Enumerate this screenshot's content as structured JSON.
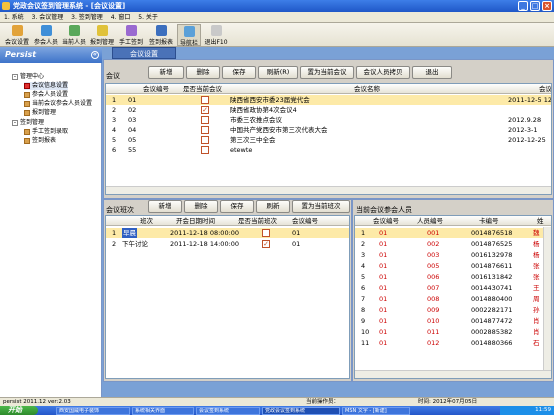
{
  "window": {
    "title": "党政会议签到管理系统 - [会议设置]"
  },
  "menu": [
    "1. 系统",
    "3. 会议管理",
    "3. 签到管理",
    "4. 窗口",
    "5. 关于"
  ],
  "toolbar": [
    {
      "label": "会议设置",
      "color": "#e2a33a"
    },
    {
      "label": "参会人员",
      "color": "#3f8fd8"
    },
    {
      "label": "当前人员",
      "color": "#5aa85a"
    },
    {
      "label": "报到管理",
      "color": "#e0c23a"
    },
    {
      "label": "手工签到",
      "color": "#9a6ad0"
    },
    {
      "label": "签到报表",
      "color": "#3c6fbe"
    },
    {
      "label": "导航栏",
      "color": "#5aa0d8"
    },
    {
      "label": "退出F10",
      "color": "#c9c9c9"
    }
  ],
  "left": {
    "title": "Persist",
    "collapse": "«",
    "tree": [
      {
        "label": "管理中心",
        "level": 0,
        "kind": "box",
        "mark": "-"
      },
      {
        "label": "会议信息设置",
        "level": 1,
        "kind": "doc",
        "selected": true
      },
      {
        "label": "参会人员设置",
        "level": 1,
        "kind": "doc"
      },
      {
        "label": "当前会议参会人员设置",
        "level": 1,
        "kind": "doc"
      },
      {
        "label": "报到管理",
        "level": 1,
        "kind": "doc"
      },
      {
        "label": "签到管理",
        "level": 0,
        "kind": "box",
        "mark": "-"
      },
      {
        "label": "手工签到录取",
        "level": 1,
        "kind": "doc"
      },
      {
        "label": "签到报表",
        "level": 1,
        "kind": "doc"
      }
    ]
  },
  "tab": {
    "label": "会议设置"
  },
  "meeting": {
    "title": "会议",
    "buttons": [
      "新增",
      "删除",
      "保存",
      "刷新(R)",
      "置为当前会议",
      "会议人员拷贝",
      "退出"
    ],
    "headers": [
      "会议编号",
      "是否当前会议",
      "会议名称",
      "会议"
    ],
    "rows": [
      {
        "idx": "1",
        "code": "01",
        "current": false,
        "name": "陕西省西安市委23届党代会",
        "date": "2011-12-5 12"
      },
      {
        "idx": "2",
        "code": "02",
        "current": true,
        "name": "陕西省政协第4次会议4",
        "date": ""
      },
      {
        "idx": "3",
        "code": "03",
        "current": false,
        "name": "市委三农推点会议",
        "date": "2012.9.28"
      },
      {
        "idx": "4",
        "code": "04",
        "current": false,
        "name": "中国共产党西安市第三次代表大会",
        "date": "2012-3-1"
      },
      {
        "idx": "5",
        "code": "05",
        "current": false,
        "name": "第三次三中全会",
        "date": "2012-12-25"
      },
      {
        "idx": "6",
        "code": "55",
        "current": false,
        "name": "etewte",
        "date": ""
      }
    ]
  },
  "session": {
    "title": "会议班次",
    "buttons": [
      "新增",
      "删除",
      "保存",
      "刷新",
      "置为当前班次"
    ],
    "headers": [
      "班次",
      "开会日期时间",
      "是否当前班次",
      "会议编号"
    ],
    "rows": [
      {
        "idx": "1",
        "name": "早晨",
        "time": "2011-12-18 08:00:00",
        "current": false,
        "code": "01"
      },
      {
        "idx": "2",
        "name": "下午讨论",
        "time": "2011-12-18 14:00:00",
        "current": true,
        "code": "01"
      }
    ]
  },
  "attendees": {
    "title": "当前会议参会人员",
    "headers": [
      "会议编号",
      "人员编号",
      "卡编号",
      "姓"
    ],
    "rows": [
      {
        "idx": "1",
        "m": "01",
        "p": "001",
        "card": "0014876518",
        "n": "魏"
      },
      {
        "idx": "2",
        "m": "01",
        "p": "002",
        "card": "0014876525",
        "n": "杨"
      },
      {
        "idx": "3",
        "m": "01",
        "p": "003",
        "card": "0016132978",
        "n": "杨"
      },
      {
        "idx": "4",
        "m": "01",
        "p": "005",
        "card": "0014876611",
        "n": "张"
      },
      {
        "idx": "5",
        "m": "01",
        "p": "006",
        "card": "0016131842",
        "n": "张"
      },
      {
        "idx": "6",
        "m": "01",
        "p": "007",
        "card": "0014430741",
        "n": "王"
      },
      {
        "idx": "7",
        "m": "01",
        "p": "008",
        "card": "0014880400",
        "n": "周"
      },
      {
        "idx": "8",
        "m": "01",
        "p": "009",
        "card": "0002282171",
        "n": "孙"
      },
      {
        "idx": "9",
        "m": "01",
        "p": "010",
        "card": "0014877472",
        "n": "肖"
      },
      {
        "idx": "10",
        "m": "01",
        "p": "011",
        "card": "0002885382",
        "n": "肖"
      },
      {
        "idx": "11",
        "m": "01",
        "p": "012",
        "card": "0014880366",
        "n": "石"
      }
    ]
  },
  "status": {
    "left": "persist 2011.12 ver:2.03",
    "mid": "当前操作员：",
    "right": "时间: 2012年07月05日 "
  },
  "taskbar": {
    "start": "开始",
    "tasks": [
      "西安国威电子装饰",
      "系统相关界面",
      "会议签到系统",
      "党政会议签到系统",
      "MSN 文字 - [新建]"
    ],
    "tray": "11:59"
  }
}
